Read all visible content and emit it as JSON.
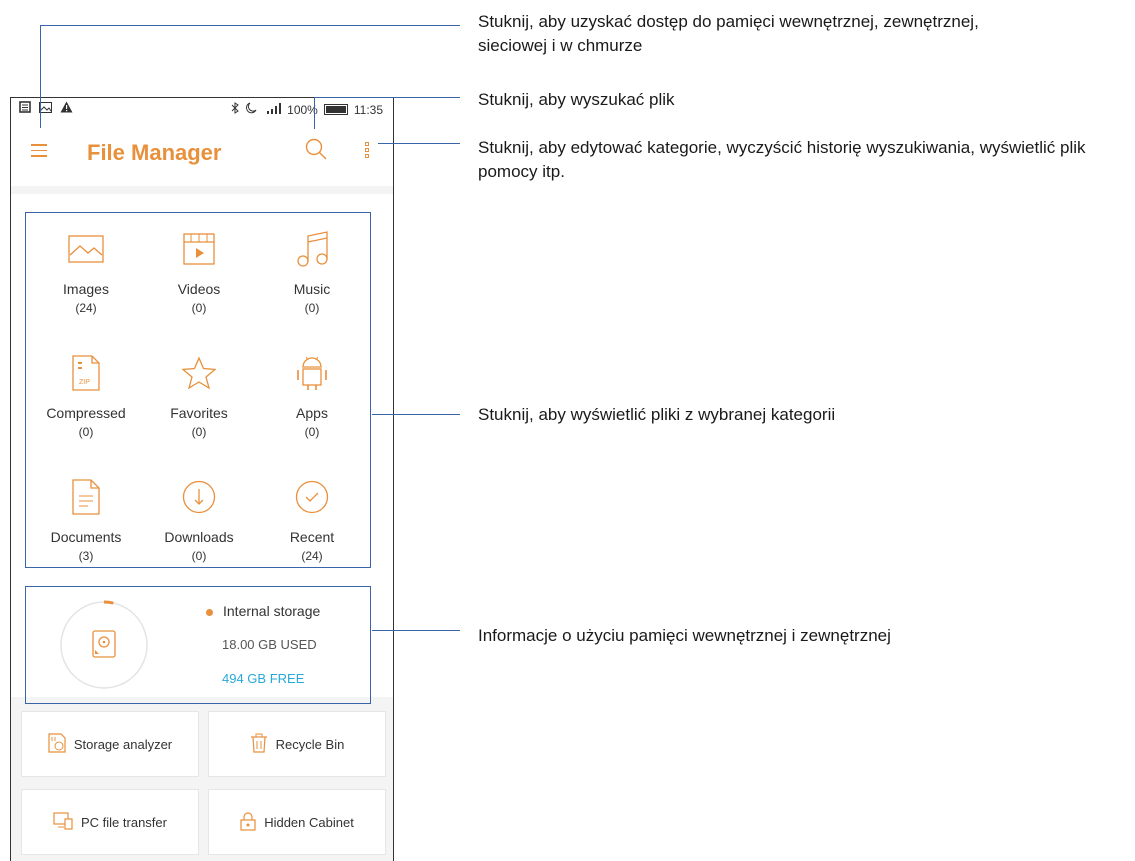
{
  "status_bar": {
    "signal": "📶",
    "battery": "100%",
    "time": "11:35"
  },
  "app": {
    "title": "File Manager"
  },
  "categories": [
    {
      "label": "Images",
      "count": "(24)"
    },
    {
      "label": "Videos",
      "count": "(0)"
    },
    {
      "label": "Music",
      "count": "(0)"
    },
    {
      "label": "Compressed",
      "count": "(0)"
    },
    {
      "label": "Favorites",
      "count": "(0)"
    },
    {
      "label": "Apps",
      "count": "(0)"
    },
    {
      "label": "Documents",
      "count": "(3)"
    },
    {
      "label": "Downloads",
      "count": "(0)"
    },
    {
      "label": "Recent",
      "count": "(24)"
    }
  ],
  "storage": {
    "name": "Internal storage",
    "used": "18.00 GB USED",
    "free": "494 GB FREE",
    "used_fraction": 0.035
  },
  "tools": [
    {
      "label": "Storage analyzer"
    },
    {
      "label": "Recycle Bin"
    },
    {
      "label": "PC file transfer"
    },
    {
      "label": "Hidden Cabinet"
    }
  ],
  "callouts": {
    "menu": "Stuknij, aby uzyskać dostęp do pamięci wewnętrznej, zewnętrznej, sieciowej i w chmurze",
    "search": "Stuknij, aby wyszukać plik",
    "more": "Stuknij, aby edytować kategorie, wyczyścić historię wyszukiwania, wyświetlić plik pomocy itp.",
    "categories": "Stuknij, aby wyświetlić pliki z wybranej kategorii",
    "storage": "Informacje o użyciu pamięci wewnętrznej i zewnętrznej"
  },
  "colors": {
    "accent": "#e8903b",
    "callout_line": "#3a64a8",
    "free": "#27a9d6"
  }
}
